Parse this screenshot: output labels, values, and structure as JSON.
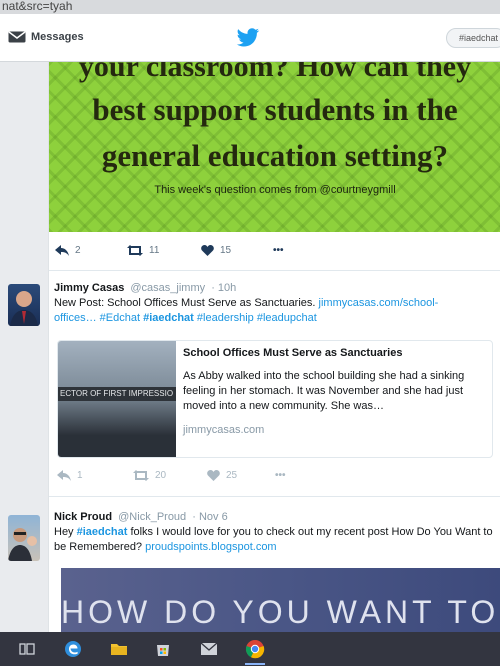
{
  "browser": {
    "url_fragment": "nat&src=tyah"
  },
  "nav": {
    "messages_label": "Messages",
    "search_value": "#iaedchat"
  },
  "card": {
    "line1": "your classroom? How can they",
    "line2": "best support students in the",
    "line3": "general education setting?",
    "credit": "This week's question comes from @courtneygmill"
  },
  "tweet1": {
    "replies": "2",
    "retweets": "11",
    "likes": "15",
    "more": "•••"
  },
  "tweet2": {
    "name": "Jimmy Casas",
    "handle": "@casas_jimmy",
    "time": "· 10h",
    "text": "New Post: School Offices Must Serve as Sanctuaries.",
    "link_a": "jimmycasas.com/school-",
    "link_b": "offices…",
    "tags": [
      "#Edchat",
      "#iaedchat",
      "#leadership",
      "#leadupchat"
    ],
    "card_title": "School Offices Must Serve as Sanctuaries",
    "card_desc": "As Abby walked into the school building she had a sinking feeling in her stomach. It was November and she had just moved into a new community. She was…",
    "card_domain": "jimmycasas.com",
    "card_sign": "ECTOR OF FIRST IMPRESSIO",
    "replies": "1",
    "retweets": "20",
    "likes": "25",
    "more": "•••"
  },
  "tweet3": {
    "name": "Nick Proud",
    "handle": "@Nick_Proud",
    "time": "· Nov 6",
    "text_a": "Hey",
    "tag": "#iaedchat",
    "text_b": "folks I would love for you to check out my recent post How Do You Want to be Remembered?",
    "link": "proudspoints.blogspot.com",
    "image_text": "HOW DO YOU WANT TO BE"
  },
  "colors": {
    "link": "#1b95e0",
    "card_green": "#8ed13c",
    "taskbar": "#333540"
  }
}
